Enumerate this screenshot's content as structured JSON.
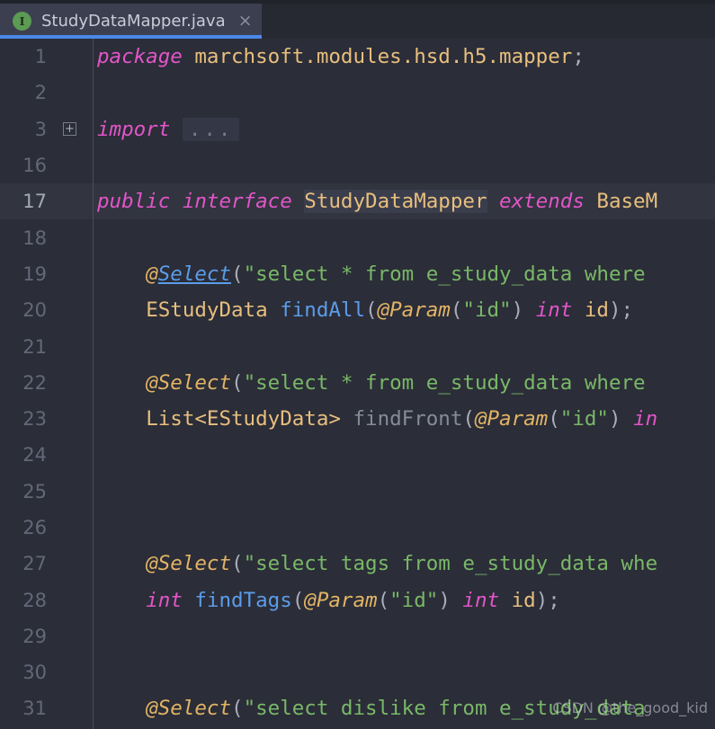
{
  "tab": {
    "icon": "interface-icon",
    "icon_glyph": "I",
    "title": "StudyDataMapper.java",
    "close_glyph": "×"
  },
  "editor": {
    "fold_marker_glyph": "+",
    "fold_placeholder": "...",
    "watermark": "CSDN @the_good_kid",
    "current_line": 17,
    "colors": {
      "background": "#2b2d38",
      "tab_active": "#3c3f50",
      "tab_underline": "#4a88e8",
      "keyword": "#cc7fdc",
      "string": "#6aa84f",
      "annotation": "#e2b465",
      "method": "#5b9ce8",
      "type": "#e8bf7e",
      "line_number": "#636879"
    },
    "lines": [
      {
        "no": "1",
        "content": "package marchsoft.modules.hsd.h5.mapper;"
      },
      {
        "no": "2",
        "content": ""
      },
      {
        "no": "3",
        "content": "import ..."
      },
      {
        "no": "16",
        "content": ""
      },
      {
        "no": "17",
        "content": "public interface StudyDataMapper extends BaseM"
      },
      {
        "no": "18",
        "content": ""
      },
      {
        "no": "19",
        "content": "    @Select(\"select * from e_study_data where"
      },
      {
        "no": "20",
        "content": "    EStudyData findAll(@Param(\"id\") int id);"
      },
      {
        "no": "21",
        "content": ""
      },
      {
        "no": "22",
        "content": "    @Select(\"select * from e_study_data where"
      },
      {
        "no": "23",
        "content": "    List<EStudyData> findFront(@Param(\"id\") in"
      },
      {
        "no": "24",
        "content": ""
      },
      {
        "no": "25",
        "content": ""
      },
      {
        "no": "26",
        "content": ""
      },
      {
        "no": "27",
        "content": "    @Select(\"select tags from e_study_data whe"
      },
      {
        "no": "28",
        "content": "    int findTags(@Param(\"id\") int id);"
      },
      {
        "no": "29",
        "content": ""
      },
      {
        "no": "30",
        "content": ""
      },
      {
        "no": "31",
        "content": "    @Select(\"select dislike from e_study_data"
      }
    ]
  }
}
